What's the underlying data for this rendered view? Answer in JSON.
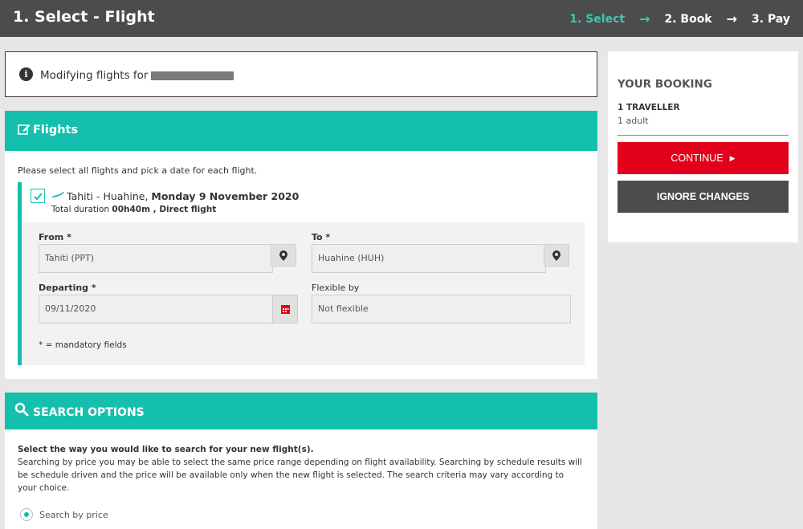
{
  "header": {
    "title": "1. Select - Flight",
    "steps": [
      {
        "label": "1. Select",
        "active": true
      },
      {
        "label": "2. Book",
        "active": false
      },
      {
        "label": "3. Pay",
        "active": false
      }
    ]
  },
  "notice": {
    "text": "Modifying flights for"
  },
  "flights": {
    "heading": "Flights",
    "instruction": "Please select all flights and pick a date for each flight.",
    "route": "Tahiti - Huahine,",
    "date": "Monday 9 November 2020",
    "duration_prefix": "Total duration",
    "duration_value": "00h40m , Direct flight",
    "from_label": "From *",
    "from_value": "Tahiti (PPT)",
    "to_label": "To *",
    "to_value": "Huahine (HUH)",
    "departing_label": "Departing *",
    "departing_value": "09/11/2020",
    "flexible_label": "Flexible by",
    "flexible_value": "Not flexible",
    "mandatory_note": "* = mandatory fields"
  },
  "search_options": {
    "heading": "SEARCH OPTIONS",
    "intro_bold": "Select the way you would like to search for your new flight(s).",
    "intro_text": "Searching by price you may be able to select the same price range depending on flight availability. Searching by schedule results will be schedule driven and the price will be available only when the new flight is selected. The search criteria may vary according to your choice.",
    "option_price": "Search by price"
  },
  "booking": {
    "title": "YOUR BOOKING",
    "travellers": "1 TRAVELLER",
    "adults": "1 adult",
    "continue_label": "CONTINUE",
    "ignore_label": "IGNORE CHANGES"
  },
  "colors": {
    "accent": "#14bfae",
    "primary_button": "#e2001a",
    "header_bg": "#4d4c4c"
  }
}
